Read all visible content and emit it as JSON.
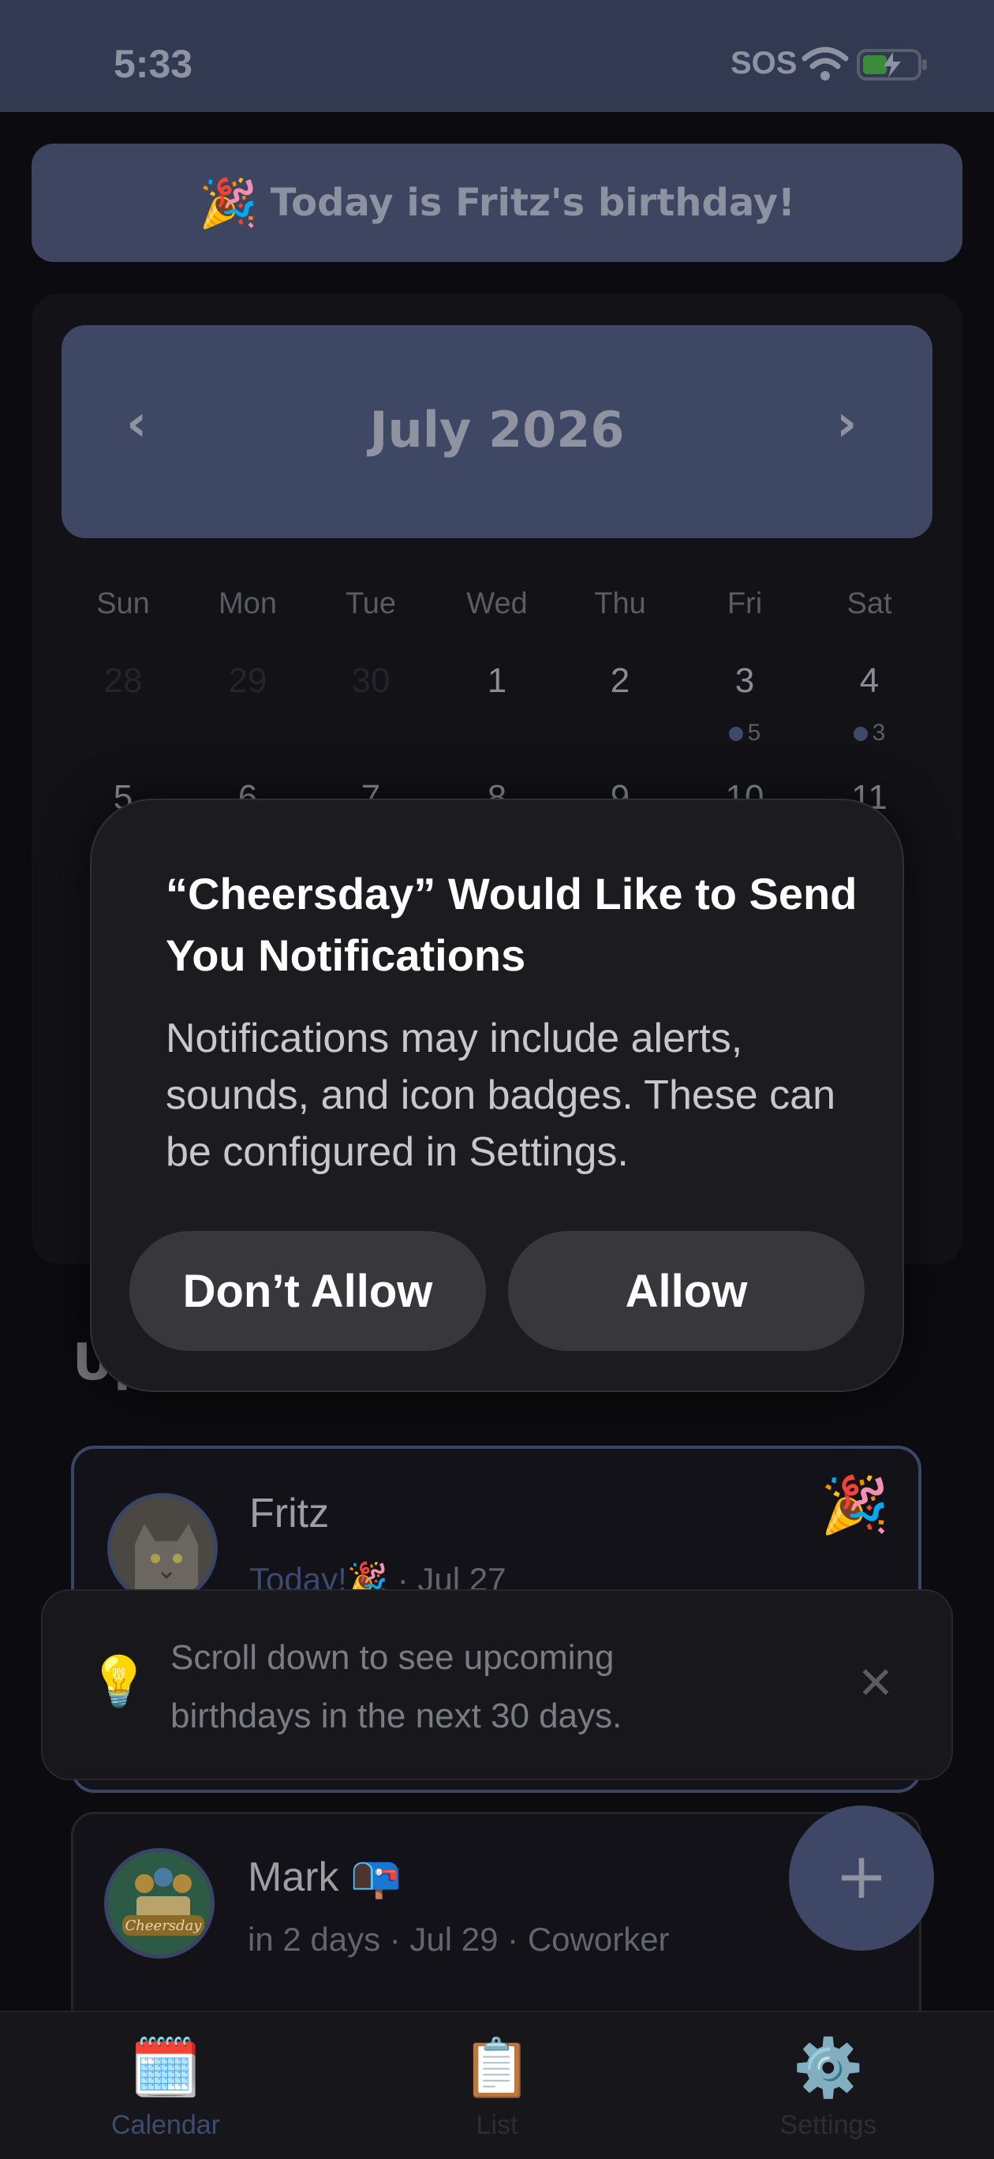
{
  "status_bar": {
    "time": "5:33",
    "sos": "SOS"
  },
  "banner": {
    "emoji": "🎉",
    "text": "Today is Fritz's birthday!"
  },
  "calendar": {
    "prev": "‹",
    "next": "›",
    "month": "July 2026",
    "weekdays": [
      "Sun",
      "Mon",
      "Tue",
      "Wed",
      "Thu",
      "Fri",
      "Sat"
    ],
    "week1": [
      "28",
      "29",
      "30",
      "1",
      "2",
      "3",
      "4"
    ],
    "week1_counts": {
      "fri": "5",
      "sat": "3"
    },
    "week2": [
      "5",
      "6",
      "7",
      "8",
      "9",
      "10",
      "11"
    ]
  },
  "section_heading": "Up",
  "cards": [
    {
      "name": "Fritz",
      "today": "Today!",
      "today_emoji": "🎉",
      "sub_rest": " · Jul 27",
      "emoji": "🎉"
    },
    {
      "name": "Mark",
      "name_emoji": "📭",
      "sub": "in 2 days · Jul 29 · Coworker",
      "avatar_label": "Cheersday"
    }
  ],
  "hint": {
    "icon": "💡",
    "text": "Scroll down to see upcoming birthdays in the next 30 days.",
    "close": "✕"
  },
  "fab": {
    "label": "+"
  },
  "tabs": [
    {
      "icon": "🗓️",
      "label": "Calendar"
    },
    {
      "icon": "📋",
      "label": "List"
    },
    {
      "icon": "⚙️",
      "label": "Settings"
    }
  ],
  "dialog": {
    "title": "“Cheersday” Would Like to Send You Notifications",
    "message": "Notifications may include alerts, sounds, and icon badges. These can be configured in Settings.",
    "dont_allow": "Don’t Allow",
    "allow": "Allow"
  }
}
